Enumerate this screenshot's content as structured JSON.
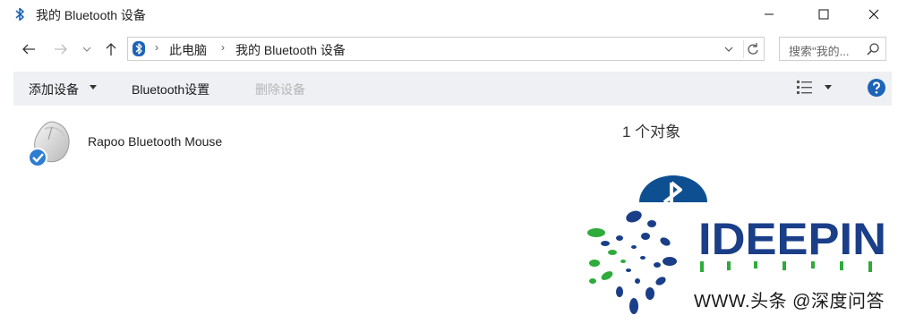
{
  "window": {
    "title": "我的 Bluetooth 设备",
    "minimize_glyph": "—",
    "maximize_glyph": "☐",
    "close_glyph": "✕"
  },
  "nav": {
    "back_icon": "back-arrow-icon",
    "forward_icon": "forward-arrow-icon",
    "recent_icon": "recent-dropdown-icon",
    "up_icon": "up-arrow-icon"
  },
  "address": {
    "crumbs": [
      "此电脑",
      "我的 Bluetooth 设备"
    ],
    "separator": "›"
  },
  "search": {
    "placeholder": "搜索\"我的..."
  },
  "toolbar": {
    "add_device": "添加设备",
    "bluetooth_settings": "Bluetooth设置",
    "remove_device": "删除设备"
  },
  "devices": [
    {
      "name": "Rapoo Bluetooth Mouse"
    }
  ],
  "details": {
    "count_label": "1 个对象"
  },
  "watermark": {
    "brand": "IDEEPIN",
    "caption": "头条 @深度问答",
    "url_prefix": "WWW."
  },
  "colors": {
    "accent": "#1c64b8",
    "bluetooth_dark": "#0e4f92",
    "command_bar_bg": "#eef0f4",
    "brand_blue": "#1a3e88",
    "brand_green": "#2eab3b"
  }
}
